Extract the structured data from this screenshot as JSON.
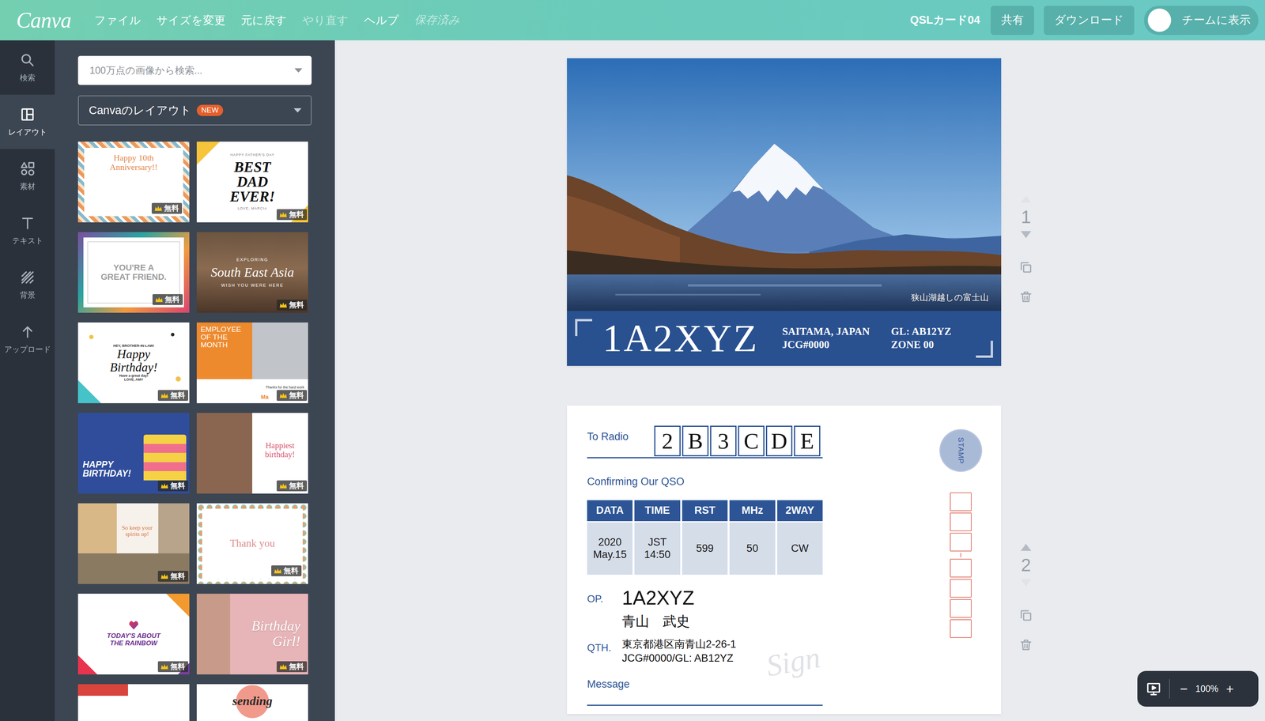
{
  "topbar": {
    "logo": "Canva",
    "menu": [
      {
        "label": "ファイル",
        "disabled": false
      },
      {
        "label": "サイズを変更",
        "disabled": false
      },
      {
        "label": "元に戻す",
        "disabled": false
      },
      {
        "label": "やり直す",
        "disabled": true
      },
      {
        "label": "ヘルプ",
        "disabled": false
      }
    ],
    "save_status": "保存済み",
    "doc_title": "QSLカード04",
    "buttons": [
      "共有",
      "ダウンロード"
    ],
    "team_toggle": {
      "label": "チームに表示",
      "on": false
    }
  },
  "rail": [
    {
      "label": "検索",
      "selected": false
    },
    {
      "label": "レイアウト",
      "selected": true
    },
    {
      "label": "素材",
      "selected": false
    },
    {
      "label": "テキスト",
      "selected": false
    },
    {
      "label": "背景",
      "selected": false
    },
    {
      "label": "アップロード",
      "selected": false
    }
  ],
  "panel": {
    "search": {
      "placeholder": "100万点の画像から検索..."
    },
    "layout_dropdown": {
      "label": "Canvaのレイアウト",
      "badge": "NEW"
    },
    "templates": [
      {
        "kind": "anniversary",
        "lines": [
          "Happy 10th",
          "Anniversary!!"
        ],
        "badge": "無料"
      },
      {
        "kind": "fathers",
        "lines": [
          "HAPPY FATHER'S DAY",
          "BEST",
          "DAD",
          "EVER!",
          "LOVE, MARCIA"
        ],
        "badge": "無料"
      },
      {
        "kind": "friend",
        "lines": [
          "YOU'RE A",
          "GREAT FRIEND."
        ],
        "badge": "無料"
      },
      {
        "kind": "travel",
        "lines": [
          "EXPLORING",
          "South East Asia",
          "WISH YOU WERE HERE"
        ],
        "badge": "無料"
      },
      {
        "kind": "brother",
        "lines": [
          "HEY, BROTHER-IN-LAW!",
          "Happy",
          "Birthday!",
          "Have a great day!",
          "LOVE, AMY"
        ],
        "badge": "無料"
      },
      {
        "kind": "employee",
        "lines": [
          "EMPLOYEE",
          "OF THE",
          "MONTH",
          "Thanks for the hard work",
          "Ma"
        ],
        "badge": "無料"
      },
      {
        "kind": "cake",
        "lines": [
          "HAPPY",
          "BIRTHDAY!"
        ],
        "badge": "無料"
      },
      {
        "kind": "happiest",
        "lines": [
          "Happiest",
          "birthday!"
        ],
        "badge": "無料"
      },
      {
        "kind": "spirits",
        "lines": [
          "So keep your",
          "spirits up!"
        ],
        "badge": "無料"
      },
      {
        "kind": "thanks",
        "lines": [
          "Thank you"
        ],
        "badge": "無料"
      },
      {
        "kind": "rainbow",
        "lines": [
          "TODAY'S ABOUT",
          "THE RAINBOW"
        ],
        "badge": "無料"
      },
      {
        "kind": "girl",
        "lines": [
          "Birthday",
          "Girl!"
        ],
        "badge": "無料"
      },
      {
        "kind": "redcard",
        "lines": []
      },
      {
        "kind": "sending",
        "lines": [
          "sending"
        ]
      }
    ]
  },
  "front_page": {
    "controls": {
      "number": "1",
      "move_up_enabled": false,
      "move_down_enabled": true
    },
    "caption": "狭山湖越しの富士山",
    "callsign": "1A2XYZ",
    "location": [
      "SAITAMA, JAPAN",
      "JCG#0000"
    ],
    "grid": [
      "GL: AB12YZ",
      "ZONE 00"
    ]
  },
  "back_page": {
    "controls": {
      "number": "2",
      "move_up_enabled": true,
      "move_down_enabled": false
    },
    "to_label": "To Radio",
    "to_call": [
      "2",
      "B",
      "3",
      "C",
      "D",
      "E"
    ],
    "confirm": "Confirming Our QSO",
    "table": {
      "columns": [
        "DATA",
        "TIME",
        "RST",
        "MHz",
        "2WAY"
      ],
      "rows": [
        [
          [
            "2020",
            "May.15"
          ],
          [
            "JST",
            "14:50"
          ],
          [
            "599"
          ],
          [
            "50"
          ],
          [
            "CW"
          ]
        ]
      ]
    },
    "op_label": "OP.",
    "op_call": "1A2XYZ",
    "op_name": "青山　武史",
    "qth_label": "QTH.",
    "qth_lines": [
      "東京都港区南青山2-26-1",
      "JCG#0000/GL: AB12YZ"
    ],
    "sign": "Sign",
    "message": "Message",
    "stamp": "STAMP"
  },
  "zoom": {
    "minus": "−",
    "level": "100%",
    "plus": "+"
  }
}
